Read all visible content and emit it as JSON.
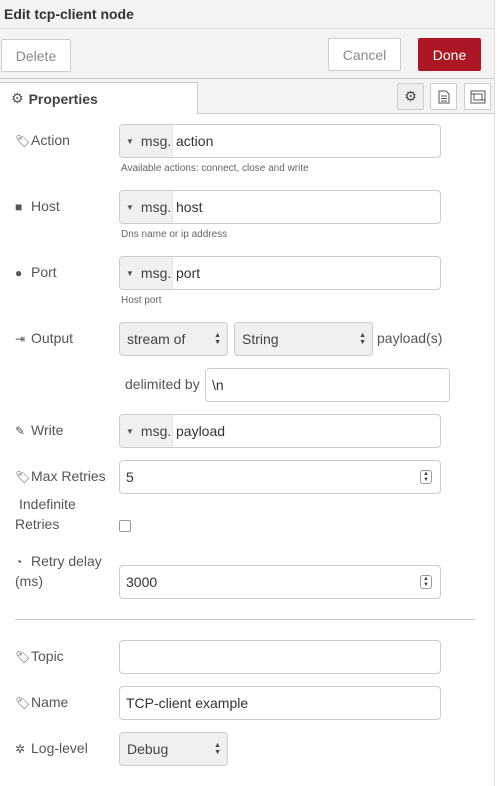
{
  "title": "Edit tcp-client node",
  "toolbar": {
    "delete_label": "Delete",
    "cancel_label": "Cancel",
    "done_label": "Done"
  },
  "tabs": {
    "properties_label": "Properties",
    "icon_tabs": [
      "gear-icon",
      "description-icon",
      "appearance-icon"
    ]
  },
  "colors": {
    "done_button": "#ad1625"
  },
  "form": {
    "action": {
      "label": "Action",
      "type_prefix": "msg.",
      "value": "action",
      "hint": "Available actions: connect, close and write"
    },
    "host": {
      "label": "Host",
      "type_prefix": "msg.",
      "value": "host",
      "hint": "Dns name or ip address"
    },
    "port": {
      "label": "Port",
      "type_prefix": "msg.",
      "value": "port",
      "hint": "Host port"
    },
    "output": {
      "label": "Output",
      "mode_value": "stream of",
      "datatype_value": "String",
      "suffix": "payload(s)",
      "delimited_label": "delimited by",
      "delimiter_value": "\\n"
    },
    "write": {
      "label": "Write",
      "type_prefix": "msg.",
      "value": "payload"
    },
    "max_retries": {
      "label": "Max Retries",
      "value": "5"
    },
    "indefinite_retries": {
      "label_line1": "Indefinite",
      "label_line2": "Retries",
      "checked": false
    },
    "retry_delay": {
      "label_line1": "Retry delay",
      "label_line2": "(ms)",
      "value": "3000"
    },
    "topic": {
      "label": "Topic",
      "value": ""
    },
    "name": {
      "label": "Name",
      "value": "TCP-client example"
    },
    "log_level": {
      "label": "Log-level",
      "value": "Debug"
    }
  }
}
